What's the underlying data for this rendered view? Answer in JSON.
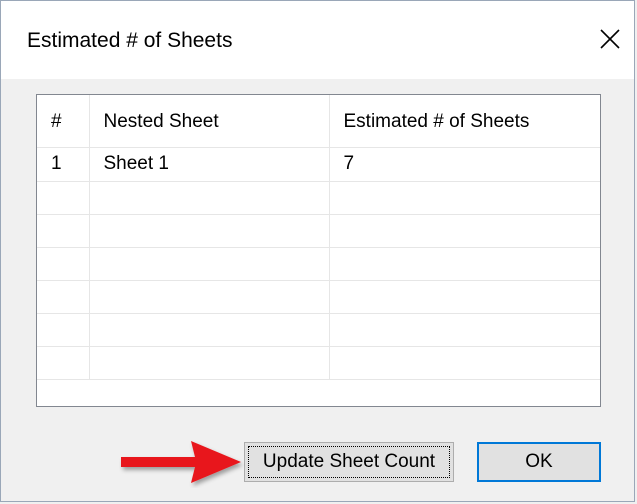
{
  "dialog": {
    "title": "Estimated # of Sheets",
    "close_icon": "close-icon"
  },
  "table": {
    "columns": [
      "#",
      "Nested Sheet",
      "Estimated # of Sheets"
    ],
    "rows": [
      {
        "index": "1",
        "nested_sheet": "Sheet 1",
        "estimated_sheets": "7"
      }
    ],
    "empty_row_count": 6
  },
  "buttons": {
    "update_label": "Update Sheet Count",
    "ok_label": "OK"
  },
  "annotation": {
    "arrow_icon": "red-arrow-icon",
    "arrow_color": "#e8191d"
  },
  "colors": {
    "ok_border": "#0078d7",
    "dialog_bg": "#f0f0f0"
  }
}
